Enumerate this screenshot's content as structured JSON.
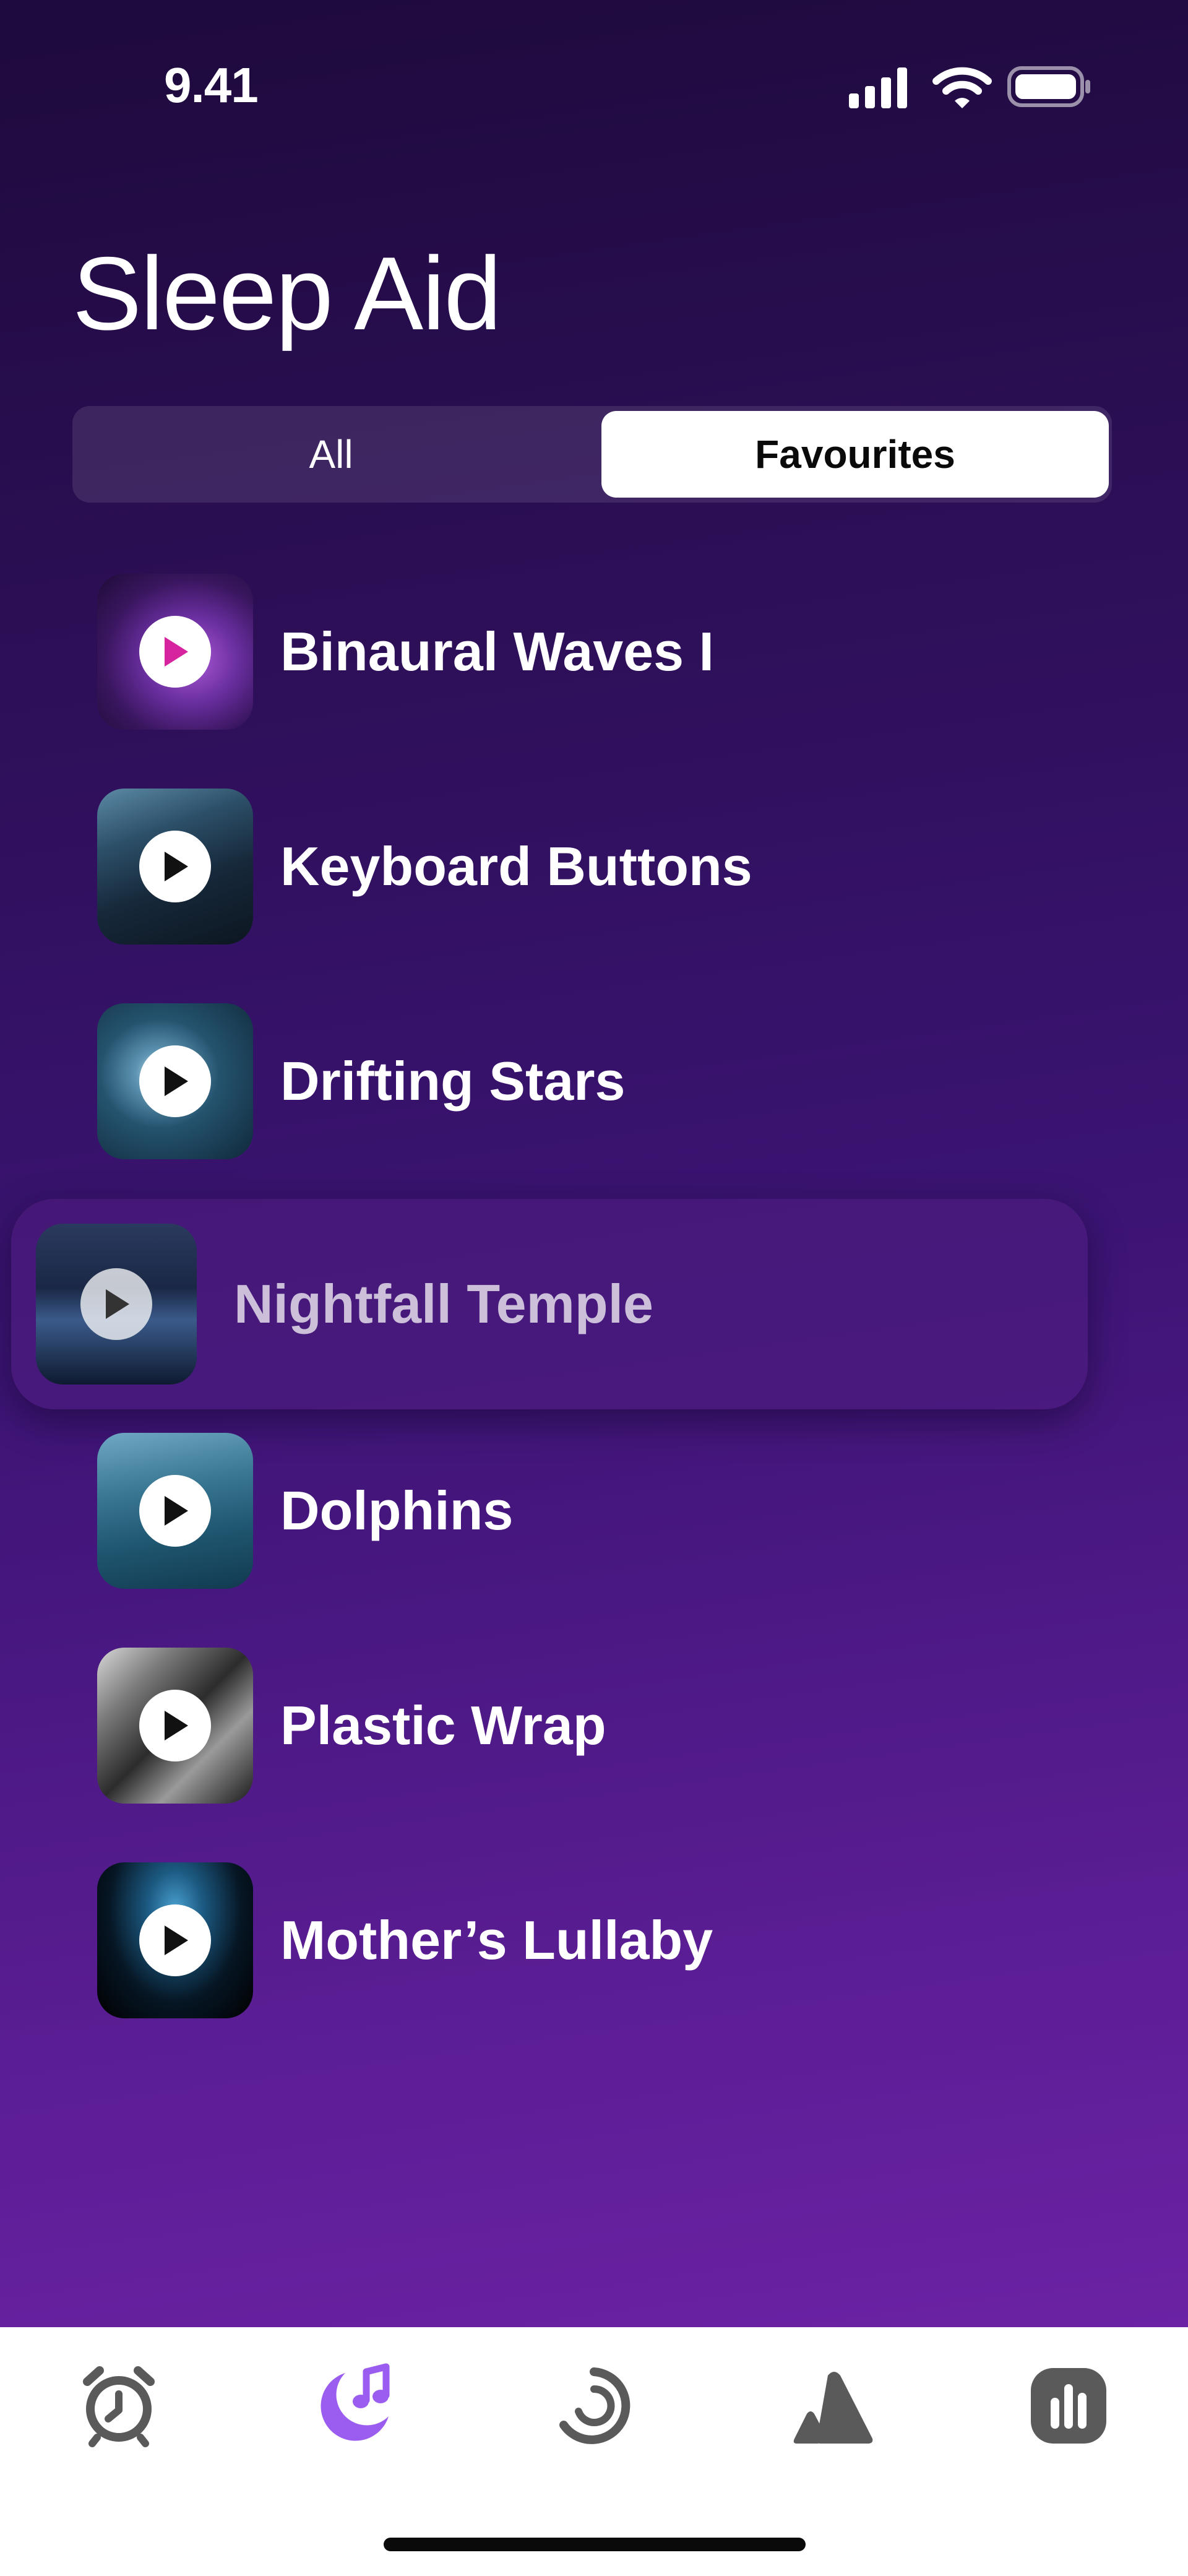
{
  "status_bar": {
    "time": "9.41"
  },
  "header": {
    "title": "Sleep Aid"
  },
  "segments": {
    "all": "All",
    "favourites": "Favourites",
    "selected": "Favourites"
  },
  "sounds": [
    {
      "label": "Binaural Waves I"
    },
    {
      "label": "Keyboard Buttons"
    },
    {
      "label": "Drifting Stars"
    },
    {
      "label": "Nightfall Temple"
    },
    {
      "label": "Dolphins"
    },
    {
      "label": "Plastic Wrap"
    },
    {
      "label": "Mother’s Lullaby"
    }
  ],
  "tab_bar": {
    "tabs": [
      "alarm-clock-icon",
      "moon-music-icon",
      "timer-icon",
      "mountain-icon",
      "stats-icon"
    ],
    "active": "moon-music-icon",
    "active_color": "#9b5cf0",
    "inactive_color": "#5a5a5a"
  },
  "colors": {
    "background_top": "#1e0a3c",
    "background_bottom": "#6b22a4",
    "accent": "#9b5cf0"
  }
}
